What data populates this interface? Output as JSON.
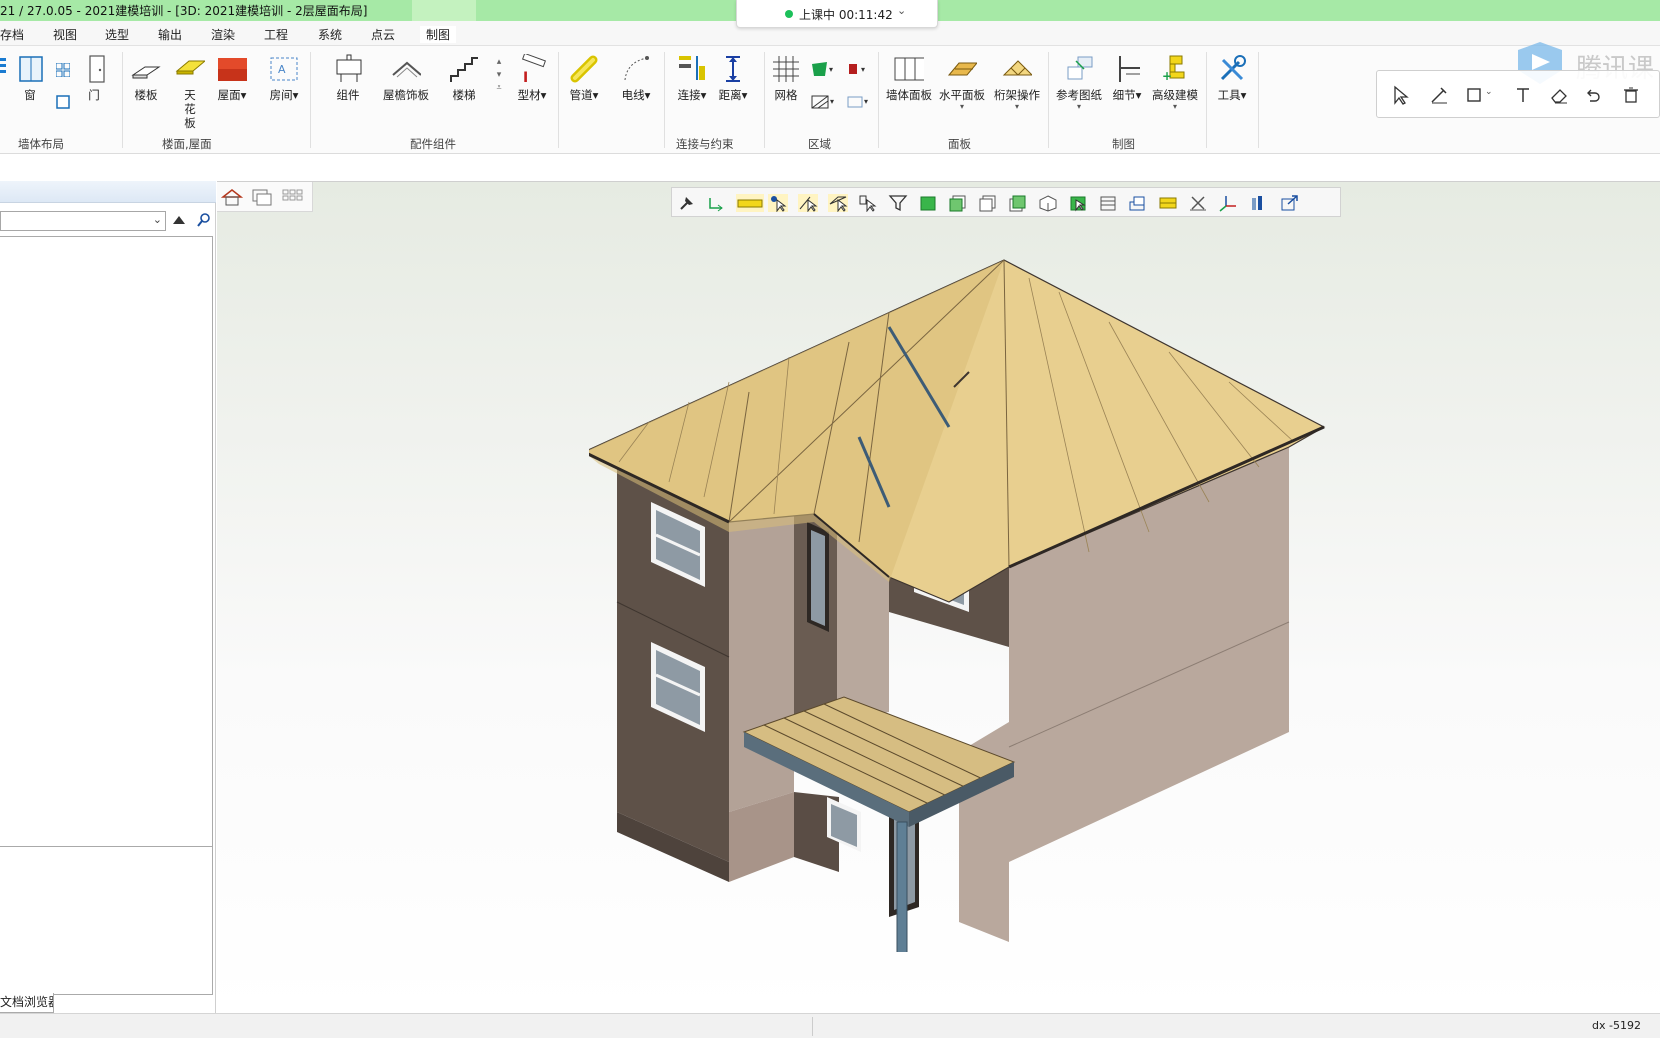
{
  "window": {
    "title": "21 / 27.0.05 - 2021建模培训 - [3D: 2021建模培训 - 2层屋面布局]"
  },
  "class_status": {
    "label": "上课中 00:11:42"
  },
  "menu": {
    "items": [
      "存档",
      "视图",
      "选型",
      "输出",
      "渲染",
      "工程",
      "系统",
      "点云",
      "制图"
    ],
    "active": "制图"
  },
  "ribbon": {
    "tools": {
      "window": "窗",
      "door": "门",
      "floor_slab": "楼板",
      "ceiling": "天花板",
      "roof": "屋面",
      "room": "房间",
      "component": "组件",
      "eave_board": "屋檐饰板",
      "stair": "楼梯",
      "profile": "型材",
      "pipe": "管道",
      "wire": "电线",
      "connect": "连接",
      "distance": "距离",
      "grid": "网格",
      "wall_panel": "墙体面板",
      "horizontal_panel": "水平面板",
      "truss_op": "桁架操作",
      "ref_drawing": "参考图纸",
      "detail": "细节",
      "advanced_modeling": "高级建模",
      "tools": "工具"
    },
    "groups": {
      "wall_layout": "墙体布局",
      "floor_roof": "楼面,屋面",
      "accessory": "配件组件",
      "connect_constraint": "连接与约束",
      "area": "区域",
      "panel": "面板",
      "drafting": "制图"
    }
  },
  "branding": {
    "text": "腾讯课"
  },
  "left_panel": {
    "tab_label": "文档浏览器"
  },
  "status": {
    "dx": "dx -5192"
  },
  "colors": {
    "title_bar": "#a6e9a6",
    "roof": "#e8cf8f",
    "wall": "#b9a89d",
    "wall_shadow": "#5e5148",
    "live_dot": "#1cc05a"
  }
}
